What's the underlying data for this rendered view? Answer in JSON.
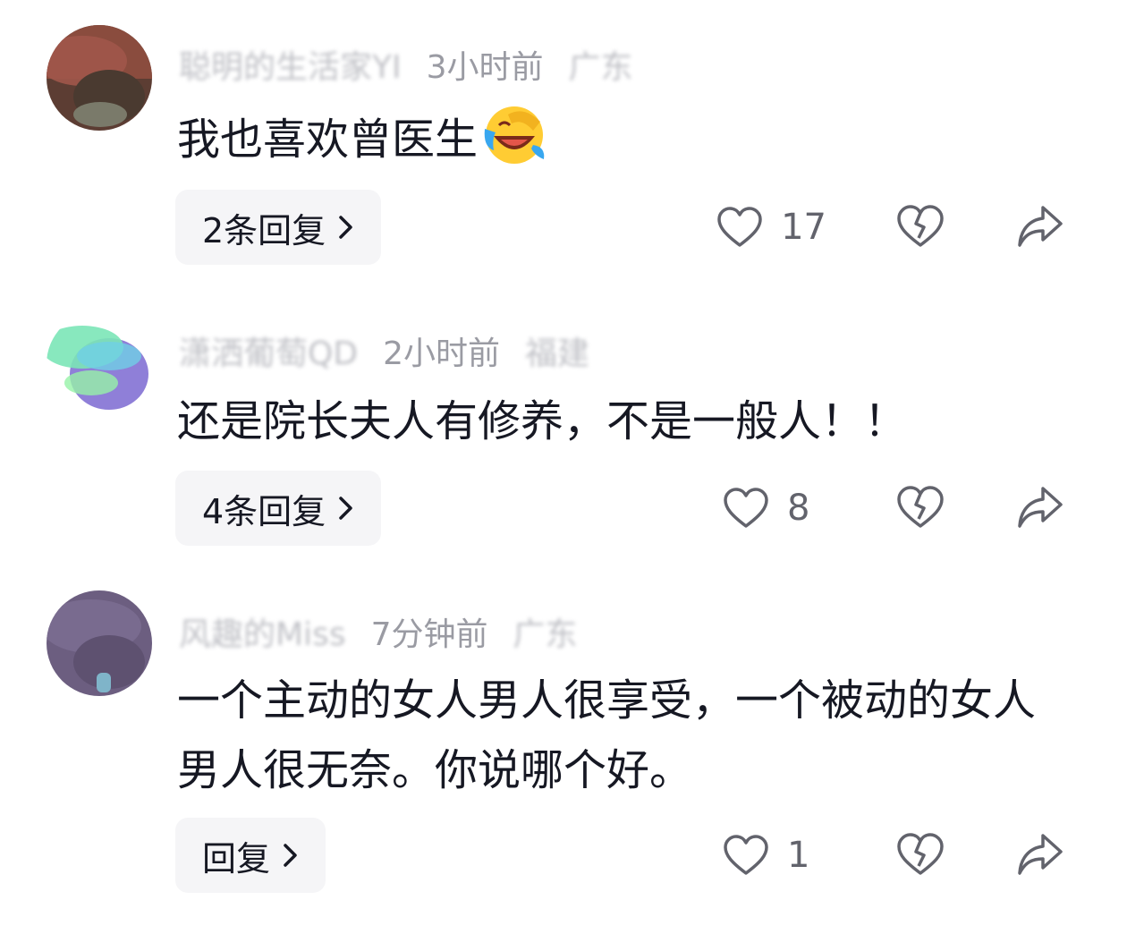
{
  "comments": [
    {
      "username": "聪明的生活家YI",
      "time": "3小时前",
      "location": "广东",
      "text": "我也喜欢曾医生",
      "emoji": "laughing-crying-emoji",
      "reply_label": "2条回复",
      "likes": "17"
    },
    {
      "username": "潇洒葡萄QD",
      "time": "2小时前",
      "location": "福建",
      "text": "还是院长夫人有修养，不是一般人！！",
      "reply_label": "4条回复",
      "likes": "8"
    },
    {
      "username": "风趣的Miss",
      "time": "7分钟前",
      "location": "广东",
      "text": "一个主动的女人男人很享受，一个被动的女人男人很无奈。你说哪个好。",
      "reply_label": "回复",
      "likes": "1"
    }
  ],
  "icons": {
    "like": "heart-outline-icon",
    "dislike": "broken-heart-icon",
    "share": "share-arrow-icon",
    "chevron": "chevron-right-icon"
  },
  "colors": {
    "meta_text": "#9a9ba3",
    "body_text": "#161823",
    "reply_bg": "#f5f5f7",
    "icon": "#62636c"
  }
}
